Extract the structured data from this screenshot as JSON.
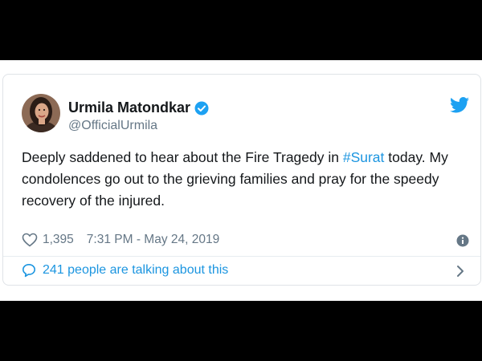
{
  "tweet": {
    "author_name": "Urmila Matondkar",
    "handle": "@OfficialUrmila",
    "text_before_hashtag": "Deeply saddened to hear about the Fire Tragedy in ",
    "hashtag": "#Surat",
    "text_after_hashtag": " today. My condolences go out to the grieving families and pray for the speedy recovery of the injured.",
    "likes": "1,395",
    "timestamp": "7:31 PM - May 24, 2019",
    "conversation": "241 people are talking about this"
  },
  "colors": {
    "accent": "#1b95e0",
    "text_primary": "#14171a",
    "text_secondary": "#657786",
    "verified_badge": "#1da1f2"
  },
  "icons": [
    "verified-badge-icon",
    "twitter-bird-icon",
    "heart-icon",
    "info-icon",
    "speech-bubble-icon",
    "chevron-right-icon"
  ]
}
